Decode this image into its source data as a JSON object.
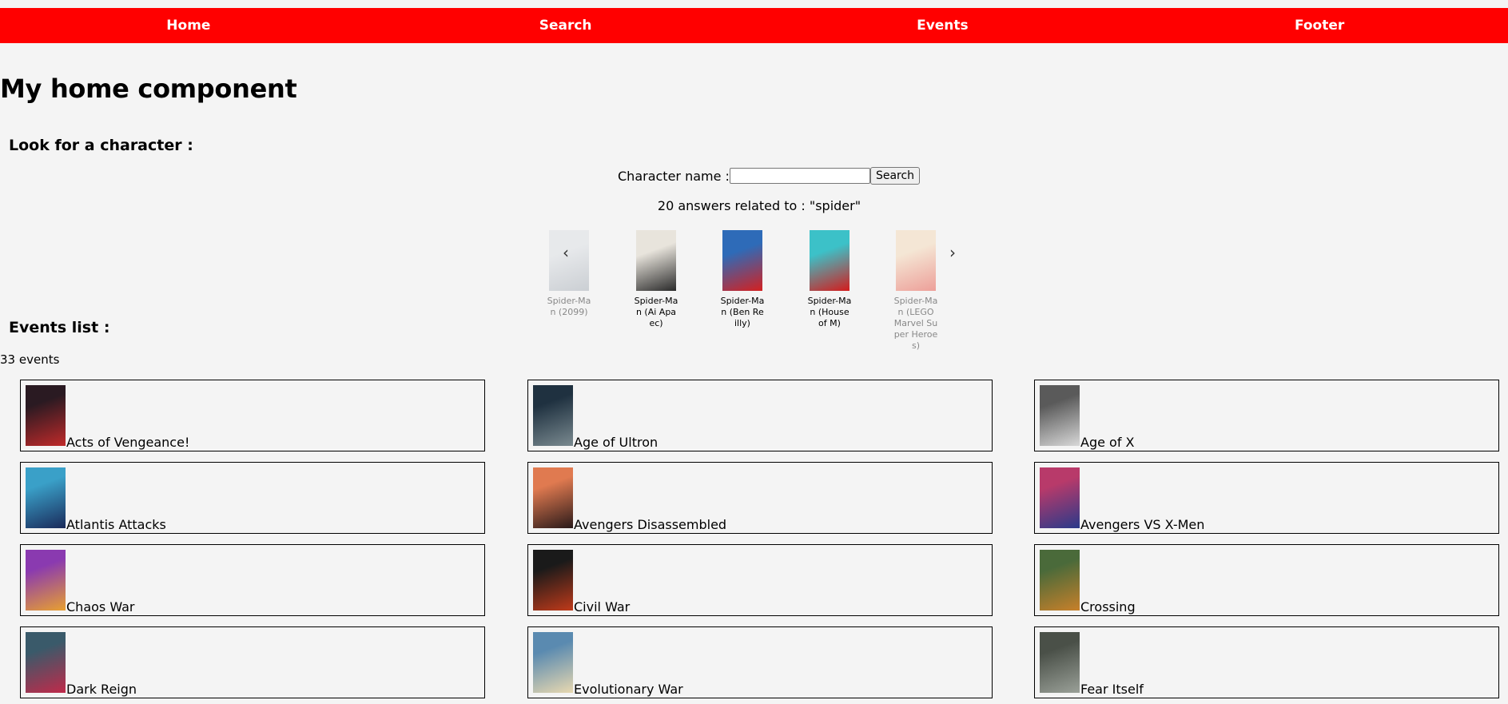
{
  "nav": {
    "items": [
      "Home",
      "Search",
      "Events",
      "Footer"
    ]
  },
  "page_title": "My home component",
  "search": {
    "section_title": "Look for a character :",
    "label": "Character name :",
    "input_value": "",
    "button_label": "Search",
    "answers_text": "20 answers related to : \"spider\""
  },
  "carousel": {
    "prev_icon": "‹",
    "next_icon": "›",
    "items": [
      {
        "label": "Spider-Man (2099)",
        "colors": [
          "#d9dde2",
          "#9aa3ad"
        ],
        "faded": true
      },
      {
        "label": "Spider-Man (Ai Apaec)",
        "colors": [
          "#e8e4dc",
          "#2a2a2a"
        ],
        "faded": false
      },
      {
        "label": "Spider-Man (Ben Reilly)",
        "colors": [
          "#2e6bb8",
          "#d42020"
        ],
        "faded": false
      },
      {
        "label": "Spider-Man (House of M)",
        "colors": [
          "#3cc1c8",
          "#d41c1c"
        ],
        "faded": false
      },
      {
        "label": "Spider-Man (LEGO Marvel Super Heroes)",
        "colors": [
          "#f6d7b0",
          "#e53a2c"
        ],
        "faded": true
      }
    ]
  },
  "events": {
    "section_title": "Events list :",
    "count_text": "33 events",
    "items": [
      {
        "name": "Acts of Vengeance!",
        "colors": [
          "#2a1a22",
          "#c02a2a"
        ]
      },
      {
        "name": "Age of Ultron",
        "colors": [
          "#1f3140",
          "#7a8a90"
        ]
      },
      {
        "name": "Age of X",
        "colors": [
          "#5a5a5a",
          "#d8d8d8"
        ]
      },
      {
        "name": "Atlantis Attacks",
        "colors": [
          "#3aa0c8",
          "#1a2a5a"
        ]
      },
      {
        "name": "Avengers Disassembled",
        "colors": [
          "#e07a50",
          "#2a1a1a"
        ]
      },
      {
        "name": "Avengers VS X-Men",
        "colors": [
          "#b83a6a",
          "#2a3a8a"
        ]
      },
      {
        "name": "Chaos War",
        "colors": [
          "#8a3ab0",
          "#e8a030"
        ]
      },
      {
        "name": "Civil War",
        "colors": [
          "#1a1a1a",
          "#c03a1a"
        ]
      },
      {
        "name": "Crossing",
        "colors": [
          "#4a6a3a",
          "#c8802a"
        ]
      },
      {
        "name": "Dark Reign",
        "colors": [
          "#3a5a6a",
          "#c02a4a"
        ]
      },
      {
        "name": "Evolutionary War",
        "colors": [
          "#5a8ab0",
          "#e8d8b0"
        ]
      },
      {
        "name": "Fear Itself",
        "colors": [
          "#4a5048",
          "#9aa098"
        ]
      }
    ]
  }
}
